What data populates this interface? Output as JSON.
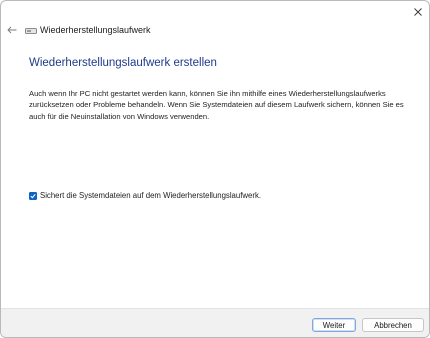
{
  "window": {
    "title": "Wiederherstellungslaufwerk",
    "icon": "drive-icon",
    "close_icon": "close-icon",
    "back_icon": "back-arrow-icon"
  },
  "main": {
    "heading": "Wiederherstellungslaufwerk erstellen",
    "description": "Auch wenn Ihr PC nicht gestartet werden kann, können Sie ihn mithilfe eines Wiederherstellungslaufwerks zurücksetzen oder Probleme behandeln. Wenn Sie Systemdateien auf diesem Laufwerk sichern, können Sie es auch für die Neuinstallation von Windows verwenden.",
    "backup_checkbox": {
      "label": "Sichert die Systemdateien auf dem Wiederherstellungslaufwerk.",
      "checked": true
    }
  },
  "footer": {
    "next_label": "Weiter",
    "cancel_label": "Abbrechen"
  },
  "colors": {
    "accent": "#0b63c4",
    "heading": "#1e3a8a",
    "footer_bg": "#f1f1f1"
  }
}
